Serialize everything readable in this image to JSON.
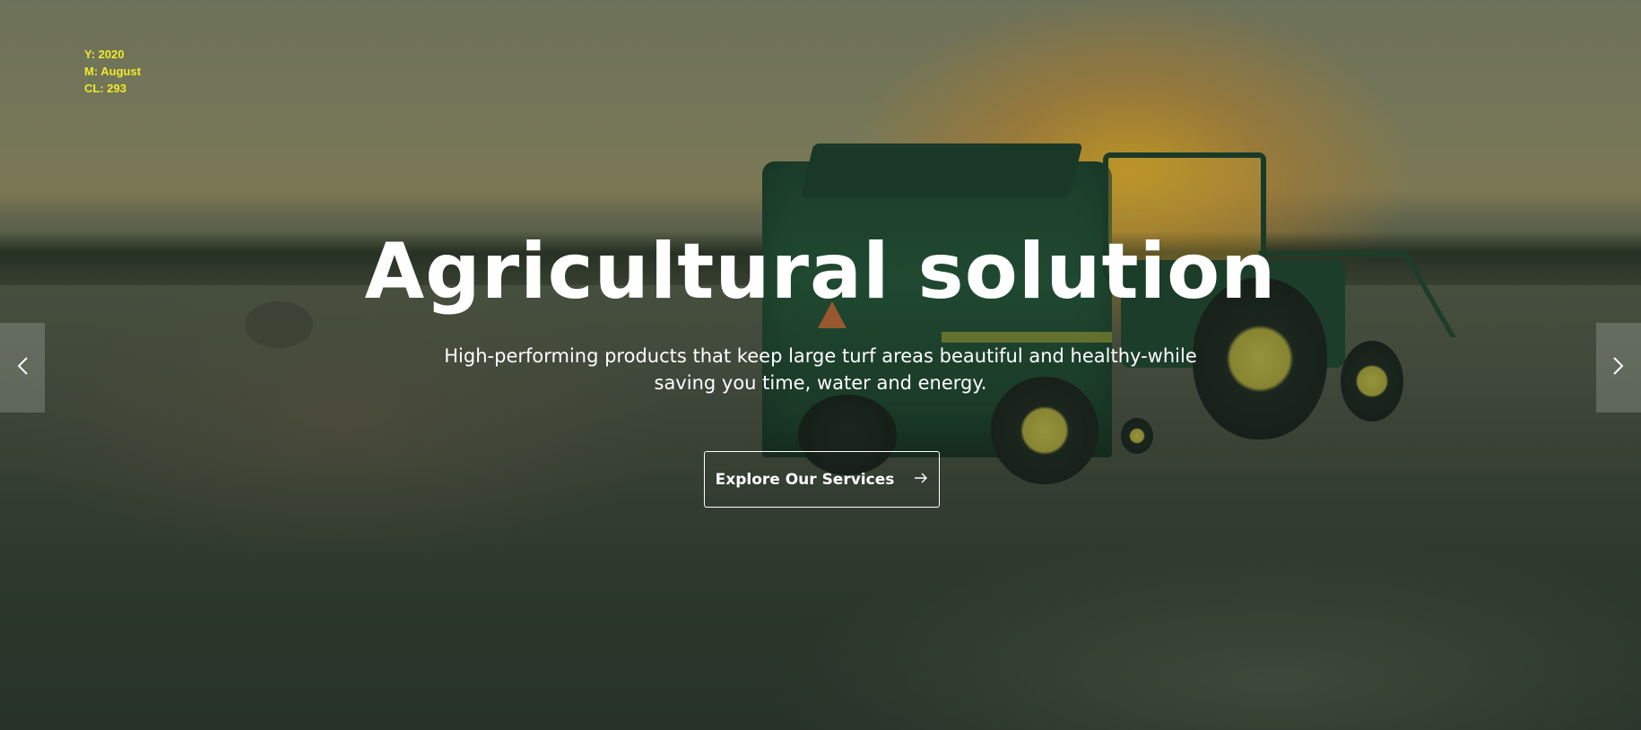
{
  "overlay_info": {
    "year": "Y: 2020",
    "month": "M: August",
    "cl": "CL: 293"
  },
  "hero": {
    "title": "Agricultural solution",
    "subtitle": "High-performing products that keep large turf areas beautiful and healthy-while saving you time, water and energy.",
    "cta_label": "Explore Our Services",
    "cta_icon": "arrow-right-icon"
  },
  "slider": {
    "prev_icon": "chevron-left-icon",
    "next_icon": "chevron-right-icon"
  },
  "colors": {
    "overlay_text": "#f0ea2a",
    "hero_text": "#ffffff"
  }
}
